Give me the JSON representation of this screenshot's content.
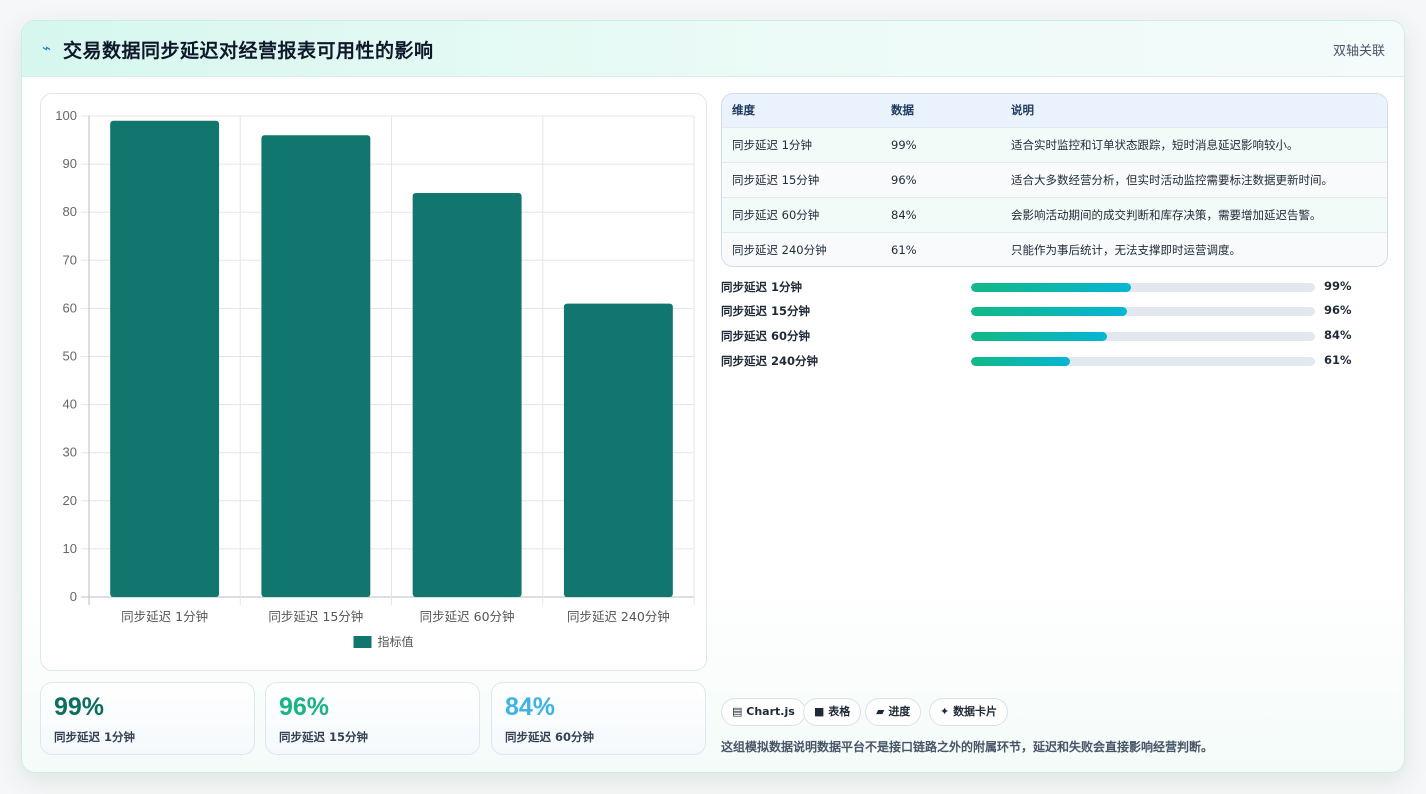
{
  "header": {
    "icon": "bolt-icon",
    "title": "交易数据同步延迟对经营报表可用性的影响",
    "tag": "双轴关联"
  },
  "chart_data": {
    "type": "bar",
    "categories": [
      "同步延迟 1分钟",
      "同步延迟 15分钟",
      "同步延迟 60分钟",
      "同步延迟 240分钟"
    ],
    "series": [
      {
        "name": "指标值",
        "values": [
          99,
          96,
          84,
          61
        ],
        "color": "#10766e"
      }
    ],
    "yticks": [
      0,
      10,
      20,
      30,
      40,
      50,
      60,
      70,
      80,
      90,
      100
    ],
    "ylim": [
      0,
      100
    ],
    "grid": true,
    "legend": "bottom"
  },
  "stats": [
    {
      "value": "99%",
      "label": "同步延迟 1分钟",
      "color": "#0f6e62"
    },
    {
      "value": "96%",
      "label": "同步延迟 15分钟",
      "color": "#1ab385"
    },
    {
      "value": "84%",
      "label": "同步延迟 60分钟",
      "color": "#3fb2e6"
    }
  ],
  "table": {
    "headers": [
      "维度",
      "数据",
      "说明"
    ],
    "rows": [
      [
        "同步延迟 1分钟",
        "99%",
        "适合实时监控和订单状态跟踪，短时消息延迟影响较小。"
      ],
      [
        "同步延迟 15分钟",
        "96%",
        "适合大多数经营分析，但实时活动监控需要标注数据更新时间。"
      ],
      [
        "同步延迟 60分钟",
        "84%",
        "会影响活动期间的成交判断和库存决策，需要增加延迟告警。"
      ],
      [
        "同步延迟 240分钟",
        "61%",
        "只能作为事后统计，无法支撑即时运营调度。"
      ]
    ]
  },
  "progress": [
    {
      "label": "同步延迟 1分钟",
      "value": "99%",
      "fill": 0.465
    },
    {
      "label": "同步延迟 15分钟",
      "value": "96%",
      "fill": 0.453
    },
    {
      "label": "同步延迟 60分钟",
      "value": "84%",
      "fill": 0.395
    },
    {
      "label": "同步延迟 240分钟",
      "value": "61%",
      "fill": 0.288
    }
  ],
  "chips": [
    {
      "icon": "chart-icon",
      "glyph": "▤",
      "label": "Chart.js"
    },
    {
      "icon": "table-icon",
      "glyph": "■",
      "label": "表格"
    },
    {
      "icon": "progress-icon",
      "glyph": "▰",
      "label": "进度"
    },
    {
      "icon": "sparkle-icon",
      "glyph": "✦",
      "label": "数据卡片"
    }
  ],
  "footnote": "这组模拟数据说明数据平台不是接口链路之外的附属环节，延迟和失败会直接影响经营判断。"
}
